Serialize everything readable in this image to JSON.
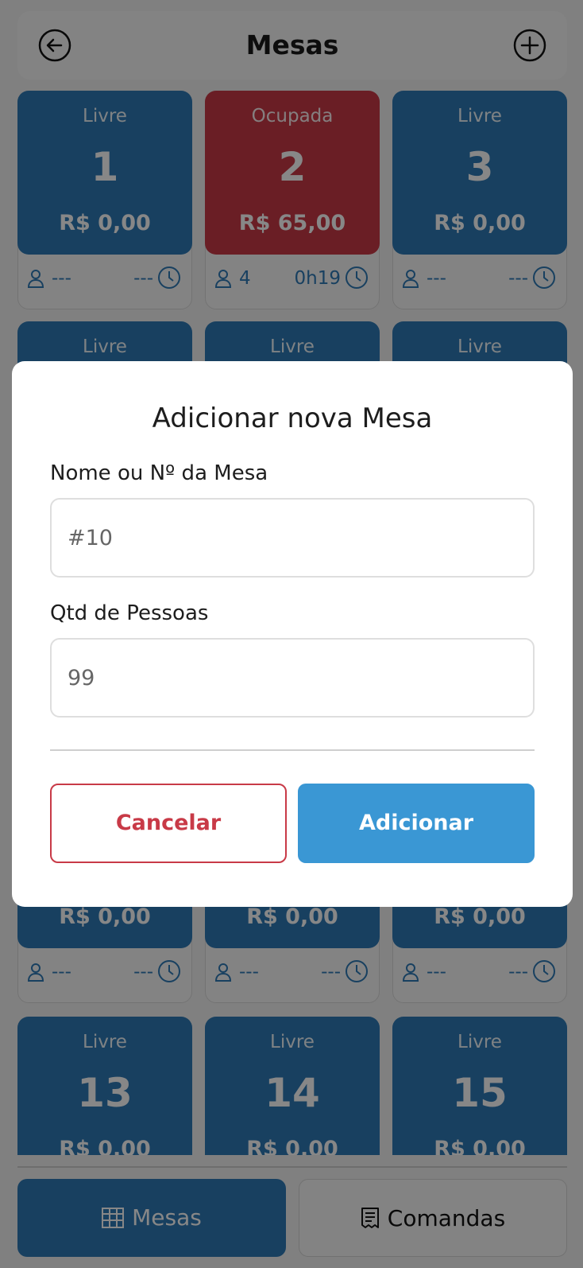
{
  "header": {
    "title": "Mesas"
  },
  "tables": [
    {
      "status": "Livre",
      "number": "1",
      "price": "R$ 0,00",
      "people": "---",
      "time": "---",
      "state": "livre"
    },
    {
      "status": "Ocupada",
      "number": "2",
      "price": "R$ 65,00",
      "people": "4",
      "time": "0h19",
      "state": "ocupada"
    },
    {
      "status": "Livre",
      "number": "3",
      "price": "R$ 0,00",
      "people": "---",
      "time": "---",
      "state": "livre"
    },
    {
      "status": "Livre",
      "number": "",
      "price": "",
      "people": "",
      "time": "",
      "state": "livre"
    },
    {
      "status": "Livre",
      "number": "",
      "price": "",
      "people": "",
      "time": "",
      "state": "livre"
    },
    {
      "status": "Livre",
      "number": "",
      "price": "",
      "people": "",
      "time": "",
      "state": "livre"
    },
    {
      "status": "",
      "number": "",
      "price": "R$ 0,00",
      "people": "---",
      "time": "---",
      "state": "livre"
    },
    {
      "status": "",
      "number": "",
      "price": "R$ 0,00",
      "people": "---",
      "time": "---",
      "state": "livre"
    },
    {
      "status": "",
      "number": "",
      "price": "R$ 0,00",
      "people": "---",
      "time": "---",
      "state": "livre"
    },
    {
      "status": "Livre",
      "number": "13",
      "price": "R$ 0,00",
      "people": "",
      "time": "",
      "state": "livre"
    },
    {
      "status": "Livre",
      "number": "14",
      "price": "R$ 0,00",
      "people": "",
      "time": "",
      "state": "livre"
    },
    {
      "status": "Livre",
      "number": "15",
      "price": "R$ 0,00",
      "people": "",
      "time": "",
      "state": "livre"
    }
  ],
  "bottom_nav": {
    "mesas_label": "Mesas",
    "comandas_label": "Comandas"
  },
  "modal": {
    "title": "Adicionar nova Mesa",
    "name_label": "Nome ou Nº da Mesa",
    "name_placeholder": "#10",
    "qty_label": "Qtd de Pessoas",
    "qty_placeholder": "99",
    "cancel_label": "Cancelar",
    "add_label": "Adicionar"
  },
  "colors": {
    "livre": "#2f7ab6",
    "ocupada": "#c83a47",
    "primary_button": "#3a97d4",
    "overlay": "rgba(0,0,0,0.47)"
  },
  "icons": {
    "back": "arrow-left-circle-icon",
    "add": "plus-circle-icon",
    "person": "person-icon",
    "clock": "clock-icon",
    "mesas_tab": "table-grid-icon",
    "comandas_tab": "receipt-icon"
  }
}
